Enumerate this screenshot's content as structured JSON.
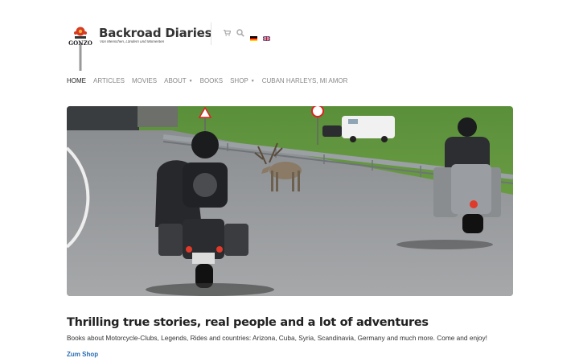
{
  "site": {
    "title": "Backroad Diaries",
    "tagline": "Von Menschen, Ländern und Momenten",
    "logo_text": "GONZO"
  },
  "header": {
    "icons": [
      "cart-icon",
      "search-icon"
    ],
    "languages": [
      "Deutsch",
      "English"
    ]
  },
  "nav": {
    "items": [
      {
        "label": "HOME",
        "active": true,
        "dropdown": false
      },
      {
        "label": "ARTICLES",
        "active": false,
        "dropdown": false
      },
      {
        "label": "MOVIES",
        "active": false,
        "dropdown": false
      },
      {
        "label": "ABOUT",
        "active": false,
        "dropdown": true
      },
      {
        "label": "BOOKS",
        "active": false,
        "dropdown": false
      },
      {
        "label": "SHOP",
        "active": false,
        "dropdown": true
      },
      {
        "label": "CUBAN HARLEYS, MI AMOR",
        "active": false,
        "dropdown": false
      }
    ]
  },
  "hero": {
    "description": "Two motorcyclists riding on a mountain road behind a reindeer crossing the road"
  },
  "content": {
    "headline": "Thrilling true stories, real people and a lot of adventures",
    "description": "Books about Motorcycle-Clubs, Legends, Rides and countries: Arizona, Cuba, Syria, Scandinavia, Germany and much more. Come and enjoy!",
    "cta": "Zum Shop"
  },
  "colors": {
    "link": "#2a6db3",
    "nav_inactive": "#888888",
    "nav_active": "#222222"
  }
}
